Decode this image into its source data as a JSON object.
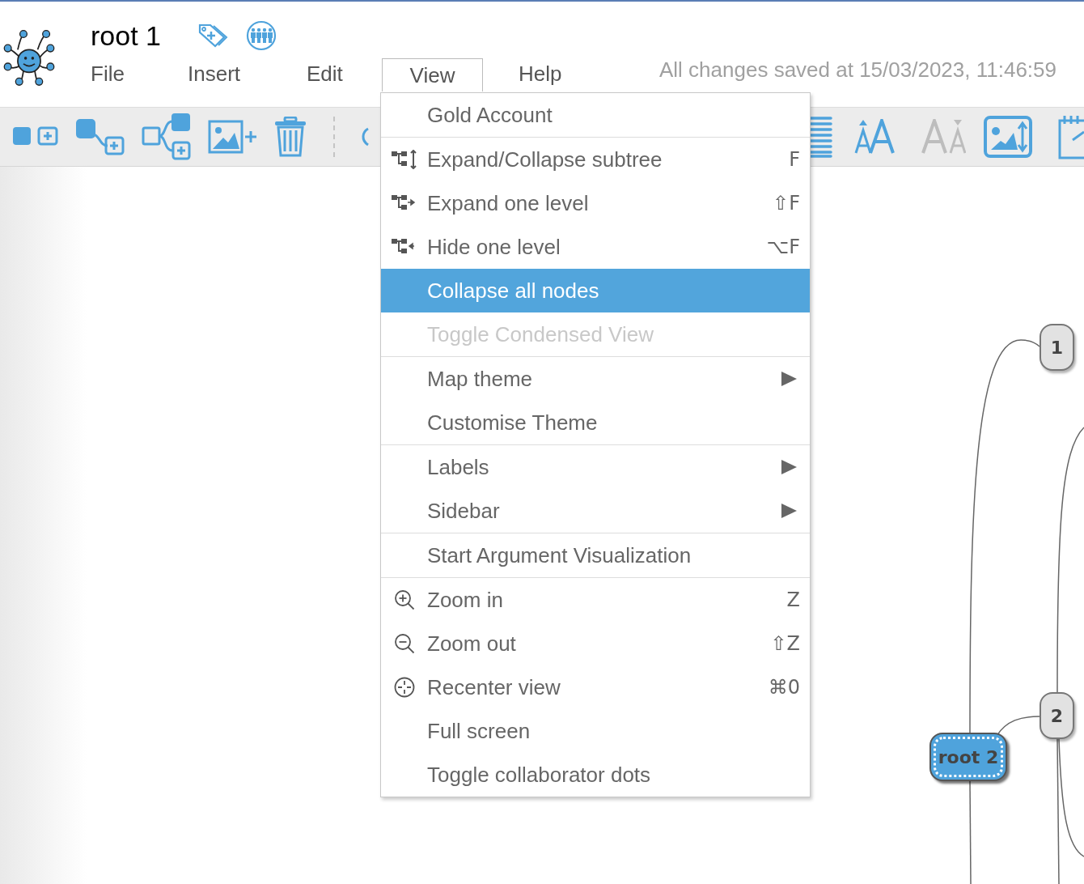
{
  "document": {
    "title": "root 1"
  },
  "menubar": [
    {
      "label": "File",
      "selected": false
    },
    {
      "label": "Insert",
      "selected": false
    },
    {
      "label": "Edit",
      "selected": false
    },
    {
      "label": "View",
      "selected": true
    },
    {
      "label": "Help",
      "selected": false
    }
  ],
  "save_status": "All changes saved at 15/03/2023, 11:46:59",
  "toolbar": {
    "left": [
      {
        "kind": "add-node",
        "disabled": false
      },
      {
        "kind": "add-child",
        "disabled": false
      },
      {
        "kind": "add-sibling",
        "disabled": false
      },
      {
        "kind": "add-image",
        "disabled": false
      },
      {
        "kind": "delete",
        "disabled": false
      },
      {
        "kind": "arc",
        "disabled": false
      }
    ],
    "right": [
      {
        "kind": "lines",
        "disabled": false
      },
      {
        "kind": "font-increase",
        "disabled": false
      },
      {
        "kind": "font-decrease",
        "disabled": true
      },
      {
        "kind": "image-resize",
        "disabled": false
      },
      {
        "kind": "notepad",
        "disabled": false
      }
    ]
  },
  "view_menu": {
    "sections": [
      {
        "items": [
          {
            "label": "Gold Account",
            "kind": "plain",
            "submenu": false,
            "selected": false,
            "disabled": false
          }
        ]
      },
      {
        "items": [
          {
            "label": "Expand/Collapse subtree",
            "kind": "tree-toggle",
            "shortcut": "F",
            "submenu": false,
            "selected": false,
            "disabled": false
          },
          {
            "label": "Expand one level",
            "kind": "tree-expand",
            "shortcut": "⇧F",
            "submenu": false,
            "selected": false,
            "disabled": false
          },
          {
            "label": "Hide one level",
            "kind": "tree-collapse",
            "shortcut": "⌥F",
            "submenu": false,
            "selected": false,
            "disabled": false
          },
          {
            "label": "Collapse all nodes",
            "kind": "plain",
            "submenu": false,
            "selected": true,
            "disabled": false
          },
          {
            "label": "Toggle Condensed View",
            "kind": "plain",
            "submenu": false,
            "selected": false,
            "disabled": true
          }
        ]
      },
      {
        "items": [
          {
            "label": "Map theme",
            "kind": "plain",
            "submenu": true,
            "selected": false,
            "disabled": false
          },
          {
            "label": "Customise Theme",
            "kind": "plain",
            "submenu": false,
            "selected": false,
            "disabled": false
          }
        ]
      },
      {
        "items": [
          {
            "label": "Labels",
            "kind": "plain",
            "submenu": true,
            "selected": false,
            "disabled": false
          },
          {
            "label": "Sidebar",
            "kind": "plain",
            "submenu": true,
            "selected": false,
            "disabled": false
          }
        ]
      },
      {
        "items": [
          {
            "label": "Start Argument Visualization",
            "kind": "plain",
            "submenu": false,
            "selected": false,
            "disabled": false
          }
        ]
      },
      {
        "items": [
          {
            "label": "Zoom in",
            "kind": "zoom-in",
            "shortcut": "Z",
            "submenu": false,
            "selected": false,
            "disabled": false
          },
          {
            "label": "Zoom out",
            "kind": "zoom-out",
            "shortcut": "⇧Z",
            "submenu": false,
            "selected": false,
            "disabled": false
          },
          {
            "label": "Recenter view",
            "kind": "recenter",
            "shortcut": "⌘0",
            "submenu": false,
            "selected": false,
            "disabled": false
          },
          {
            "label": "Full screen",
            "kind": "plain",
            "submenu": false,
            "selected": false,
            "disabled": false
          },
          {
            "label": "Toggle collaborator dots",
            "kind": "plain",
            "submenu": false,
            "selected": false,
            "disabled": false
          }
        ]
      }
    ]
  },
  "mind_map": {
    "nodes": [
      {
        "label": "1",
        "kind": "topic"
      },
      {
        "label": "2",
        "kind": "topic"
      },
      {
        "label": "root 2",
        "kind": "root"
      }
    ]
  }
}
